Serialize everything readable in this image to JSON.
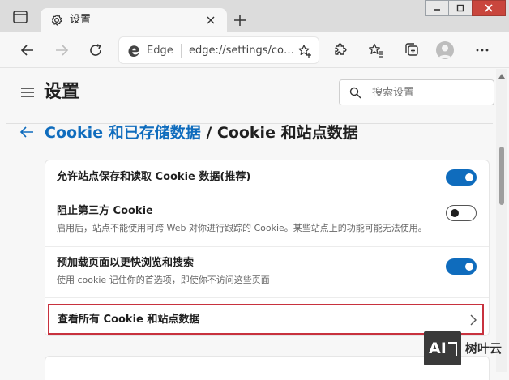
{
  "window": {
    "tab": {
      "icon": "gear-icon",
      "title": "设置"
    },
    "controls": [
      "minimize-icon",
      "maximize-icon",
      "close-icon"
    ]
  },
  "toolbar": {
    "omnibox": {
      "site_label": "Edge",
      "url": "edge://settings/co…"
    },
    "icons": [
      "back-arrow-icon",
      "forward-arrow-icon",
      "refresh-icon",
      "extensions-icon",
      "favorites-icon",
      "collections-icon",
      "profile-avatar",
      "more-icon"
    ]
  },
  "settings": {
    "title": "设置",
    "search": {
      "placeholder": "搜索设置"
    },
    "breadcrumb": {
      "parent": "Cookie 和已存储数据",
      "separator": " / ",
      "current": "Cookie 和站点数据"
    },
    "rows": [
      {
        "title": "允许站点保存和读取 Cookie 数据(推荐)",
        "description": "",
        "toggle": "on"
      },
      {
        "title": "阻止第三方 Cookie",
        "description": "启用后，站点不能使用可跨 Web 对你进行跟踪的 Cookie。某些站点上的功能可能无法使用。",
        "toggle": "off"
      },
      {
        "title": "预加载页面以更快浏览和搜索",
        "description": "使用 cookie 记住你的首选项，即使你不访问这些页面",
        "toggle": "on"
      },
      {
        "title": "查看所有 Cookie 和站点数据",
        "description": "",
        "toggle": ""
      }
    ]
  },
  "colors": {
    "accent": "#0f6cbd",
    "highlight_border": "#c8323e"
  },
  "watermark": {
    "text": "树叶云",
    "logo_text": "AI"
  }
}
